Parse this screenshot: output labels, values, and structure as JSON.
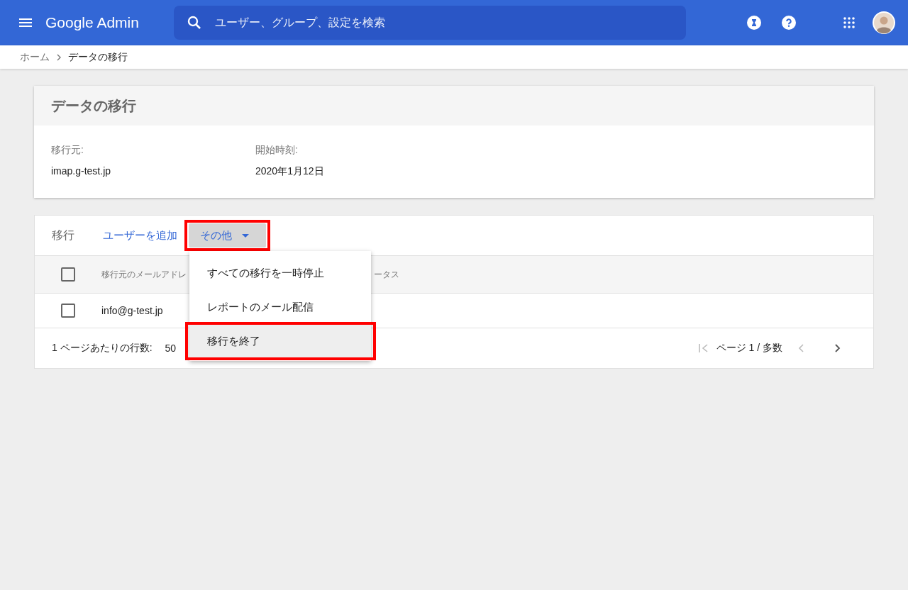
{
  "topbar": {
    "logo": "Google Admin",
    "search": {
      "placeholder": "ユーザー、グループ、設定を検索"
    }
  },
  "breadcrumb": [
    {
      "label": "ホーム",
      "current": false
    },
    {
      "label": "データの移行",
      "current": true
    }
  ],
  "summary": {
    "title": "データの移行",
    "fields": [
      {
        "label": "移行元:",
        "value": "imap.g-test.jp"
      },
      {
        "label": "開始時刻:",
        "value": "2020年1月12日"
      }
    ]
  },
  "migrations": {
    "title": "移行",
    "actions": [
      {
        "label": "ユーザーを追加",
        "kind": "link",
        "highlighted": false,
        "expanded": false
      },
      {
        "label": "その他",
        "kind": "dropdown",
        "highlighted": true,
        "expanded": true
      }
    ],
    "menu": [
      {
        "label": "すべての移行を一時停止",
        "hovered": false,
        "highlighted": false
      },
      {
        "label": "レポートのメール配信",
        "hovered": false,
        "highlighted": false
      },
      {
        "label": "移行を終了",
        "hovered": true,
        "highlighted": true
      }
    ],
    "table": {
      "columns": [
        "移行元のメールアドレ",
        "ータス"
      ],
      "header_checked": false,
      "rows": [
        {
          "email": "info@g-test.jp",
          "checked": false
        }
      ]
    },
    "footer": {
      "rows_label": "1 ページあたりの行数:",
      "rows_value": "50",
      "page": "ページ 1 / 多数"
    }
  }
}
